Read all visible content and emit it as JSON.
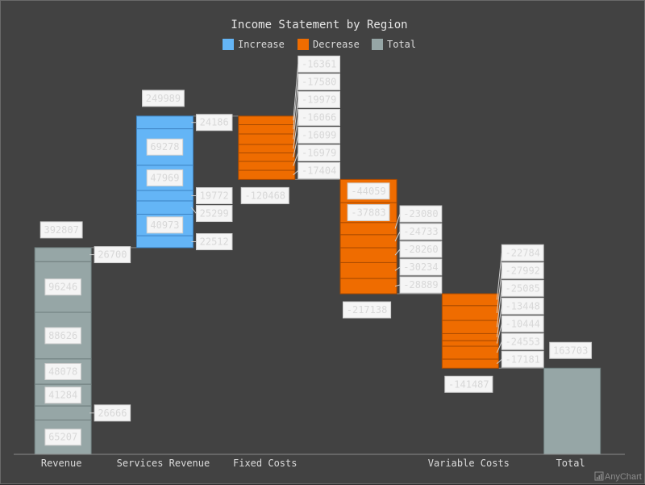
{
  "chart_data": {
    "type": "waterfall",
    "title": "Income Statement by Region",
    "xlabel": "",
    "ylabel": "",
    "grid": false,
    "legend_position": "top-center",
    "legend": [
      {
        "name": "Increase",
        "color": "#64b5f6"
      },
      {
        "name": "Decrease",
        "color": "#ef6c00"
      },
      {
        "name": "Total",
        "color": "#96a6a6"
      }
    ],
    "colors": {
      "increase": "#64b5f6",
      "decrease": "#ef6c00",
      "total": "#96a6a6",
      "background": "#424242",
      "label_bg": "#f5f5f5",
      "label_text": "#d8d8d8",
      "axis": "#8a8a8a"
    },
    "ylim": [
      0,
      700000
    ],
    "categories": [
      {
        "name": "Revenue",
        "kind": "total",
        "total": 392807,
        "segments": [
          26700,
          96246,
          88626,
          48078,
          41284,
          26666,
          65207
        ]
      },
      {
        "name": "Services Revenue",
        "kind": "increase",
        "total": 249989,
        "segments": [
          24186,
          69278,
          47969,
          19772,
          25299,
          40973,
          22512
        ]
      },
      {
        "name": "Fixed Costs",
        "kind": "decrease",
        "total": -120468,
        "segments": [
          -16361,
          -17580,
          -19979,
          -16066,
          -16099,
          -16979,
          -17404
        ]
      },
      {
        "name": "",
        "kind": "decrease",
        "total": -217138,
        "segments": [
          -44059,
          -37883,
          -23080,
          -24733,
          -28260,
          -30234,
          -28889
        ]
      },
      {
        "name": "Variable Costs",
        "kind": "decrease",
        "total": -141487,
        "segments": [
          -22784,
          -27992,
          -25085,
          -13448,
          -10444,
          -24553,
          -17181
        ]
      },
      {
        "name": "Total",
        "kind": "total",
        "total": 163703,
        "segments": [
          163703
        ]
      }
    ]
  },
  "credit": "AnyChart"
}
